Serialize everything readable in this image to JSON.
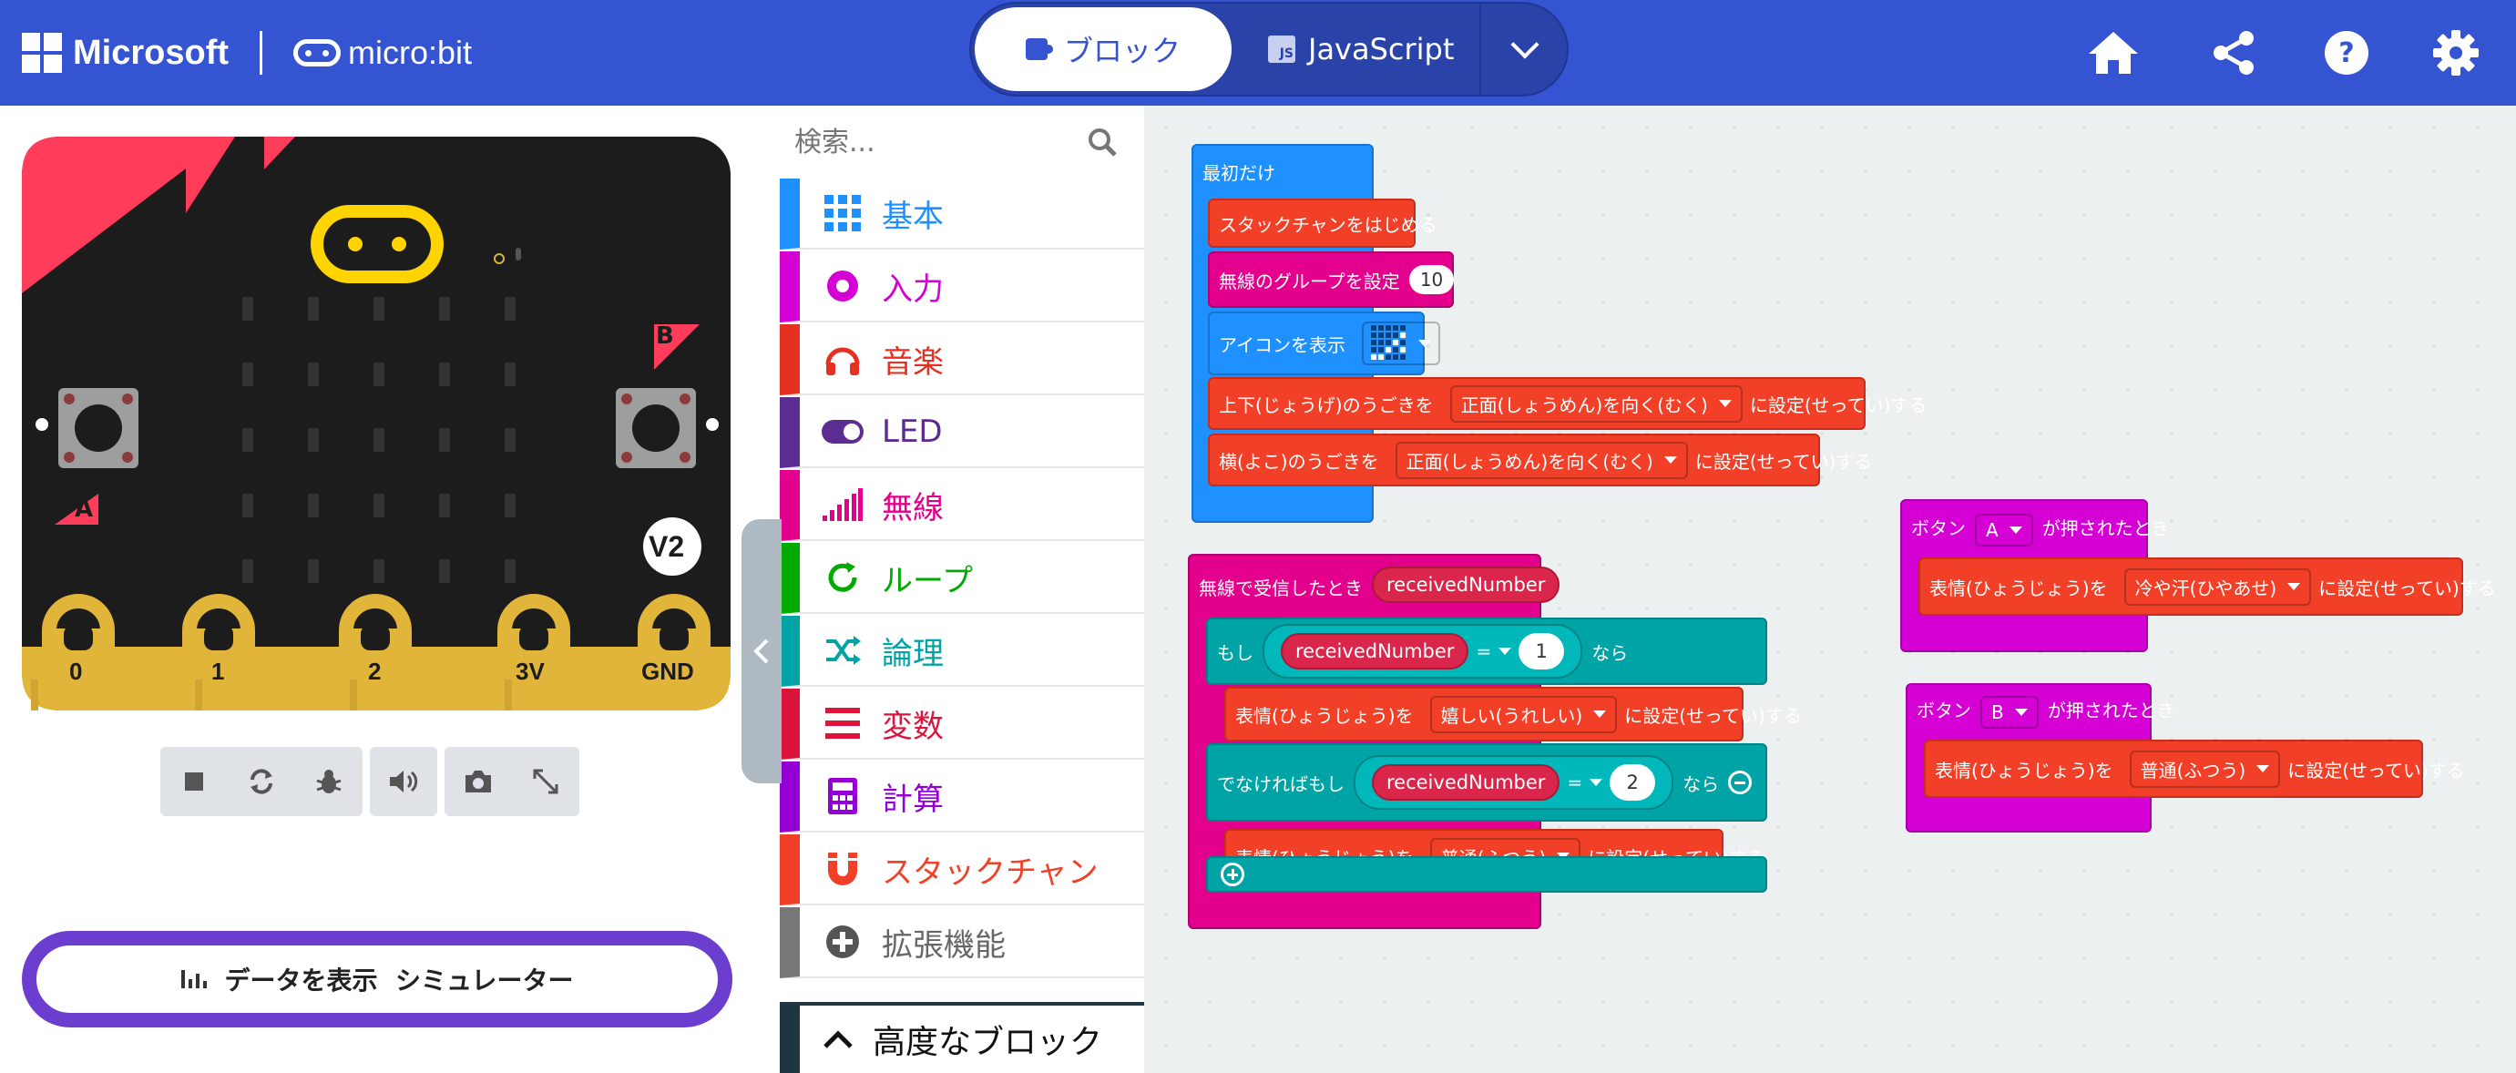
{
  "header": {
    "microsoft_label": "Microsoft",
    "microbit_label": "micro:bit",
    "mode_blocks": "ブロック",
    "mode_js": "JavaScript",
    "js_badge": "JS",
    "icons": [
      "home-icon",
      "share-icon",
      "help-icon",
      "settings-icon"
    ]
  },
  "simulator": {
    "version_badge": "V2",
    "button_a": "A",
    "button_b": "B",
    "pins": [
      "0",
      "1",
      "2",
      "3V",
      "GND"
    ],
    "data_button_label": "データを表示  シミュレーター",
    "controls": [
      "stop-icon",
      "restart-icon",
      "debug-icon",
      "sound-icon",
      "screenshot-icon",
      "fullscreen-icon"
    ]
  },
  "toolbox": {
    "search_placeholder": "検索...",
    "categories": [
      {
        "label": "基本",
        "color": "#1e90ff",
        "icon": "grid-icon"
      },
      {
        "label": "入力",
        "color": "#d400d4",
        "icon": "input-circle-icon"
      },
      {
        "label": "音楽",
        "color": "#e63022",
        "icon": "headphones-icon"
      },
      {
        "label": "LED",
        "color": "#5c2d91",
        "icon": "toggle-icon"
      },
      {
        "label": "無線",
        "color": "#e3008c",
        "icon": "signal-bars-icon"
      },
      {
        "label": "ループ",
        "color": "#00aa00",
        "icon": "refresh-icon"
      },
      {
        "label": "論理",
        "color": "#00a4a6",
        "icon": "shuffle-icon"
      },
      {
        "label": "変数",
        "color": "#dc143c",
        "icon": "list-lines-icon"
      },
      {
        "label": "計算",
        "color": "#9400d3",
        "icon": "calculator-icon"
      },
      {
        "label": "スタックチャン",
        "color": "#f24028",
        "icon": "magnet-icon"
      },
      {
        "label": "拡張機能",
        "color": "#777777",
        "icon": "plus-circle-icon"
      }
    ],
    "advanced_label": "高度なブロック"
  },
  "workspace": {
    "on_start": {
      "hat": "最初だけ",
      "b1": "スタックチャンをはじめる",
      "b2": "無線のグループを設定",
      "b2_value": "10",
      "b3": "アイコンを表示",
      "b4_prefix": "上下(じょうげ)のうごきを",
      "b4_option": "正面(しょうめん)を向く(むく)",
      "b4_suffix": "に設定(せってい)する",
      "b5_prefix": "横(よこ)のうごきを",
      "b5_option": "正面(しょうめん)を向く(むく)",
      "b5_suffix": "に設定(せってい)する"
    },
    "radio_received": {
      "hat": "無線で受信したとき",
      "hat_var": "receivedNumber",
      "if_label": "もし",
      "if_var": "receivedNumber",
      "if_op": "=",
      "if_value": "1",
      "then_label": "なら",
      "face1_prefix": "表情(ひょうじょう)を",
      "face1_option": "嬉しい(うれしい)",
      "face1_suffix": "に設定(せってい)する",
      "elseif_label": "でなければもし",
      "elseif_var": "receivedNumber",
      "elseif_op": "=",
      "elseif_value": "2",
      "elseif_then": "なら",
      "face2_prefix": "表情(ひょうじょう)を",
      "face2_option": "普通(ふつう)",
      "face2_suffix": "に設定(せってい)する"
    },
    "button_a": {
      "prefix": "ボタン",
      "button": "A",
      "suffix": "が押されたとき",
      "face_prefix": "表情(ひょうじょう)を",
      "face_option": "冷や汗(ひやあせ)",
      "face_suffix": "に設定(せってい)する"
    },
    "button_b": {
      "prefix": "ボタン",
      "button": "B",
      "suffix": "が押されたとき",
      "face_prefix": "表情(ひょうじょう)を",
      "face_option": "普通(ふつう)",
      "face_suffix": "に設定(せってい)する"
    }
  },
  "colors": {
    "header": "#3454d1",
    "basic": "#1e90ff",
    "radio": "#e3008c",
    "logic": "#00a4a6",
    "stackchan": "#f24028",
    "input": "#d400d4",
    "board": "#1c1c1c",
    "board_accent": "#ff3d5a",
    "pin_gold": "#e0b53a"
  }
}
